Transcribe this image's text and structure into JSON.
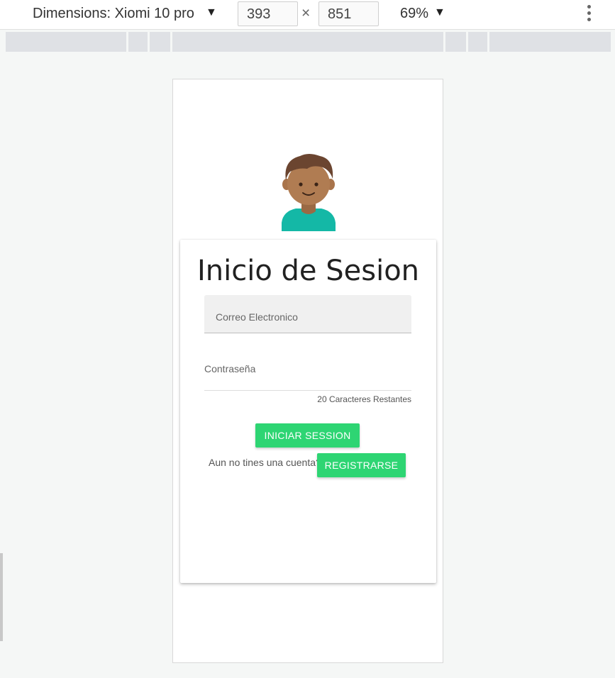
{
  "devtools": {
    "dimensions_label": "Dimensions: Xiomi 10 pro",
    "width_value": "393",
    "times_symbol": "×",
    "height_value": "851",
    "zoom_label": "69%"
  },
  "app": {
    "login_title": "Inicio de Sesion",
    "email_placeholder": "Correo Electronico",
    "password_placeholder": "Contraseña",
    "chars_remaining": "20 Caracteres Restantes",
    "login_button": "INICIAR SESSION",
    "no_account_text": "Aun no tines una cuenta?",
    "register_button": "REGISTRARSE"
  },
  "icons": {
    "avatar": "boy-avatar-icon",
    "dropdown": "caret-down-icon",
    "menu": "more-vertical-icon"
  },
  "colors": {
    "accent": "#2ed573",
    "avatar_shirt": "#14b8a6",
    "avatar_hair": "#6b4530",
    "avatar_skin": "#b07c52"
  }
}
